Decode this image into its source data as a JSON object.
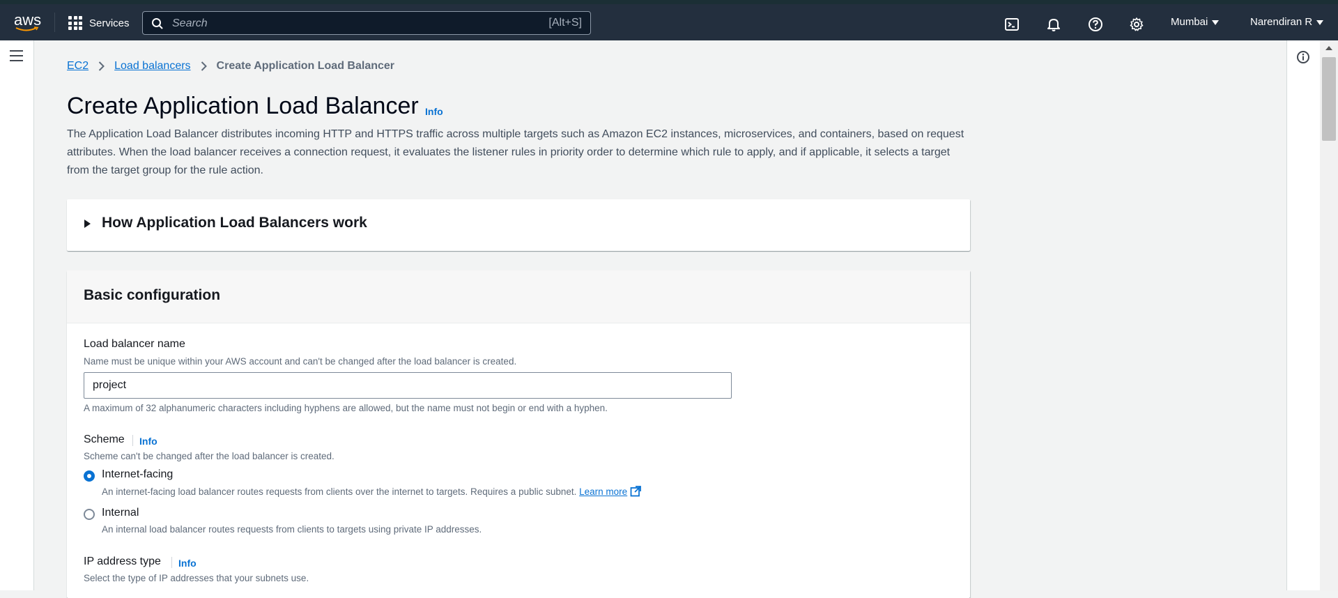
{
  "topbar": {
    "logo_text": "aws",
    "services_label": "Services",
    "search_placeholder": "Search",
    "search_shortcut": "[Alt+S]",
    "region": "Mumbai",
    "user": "Narendiran R"
  },
  "breadcrumb": {
    "items": [
      "EC2",
      "Load balancers"
    ],
    "current": "Create Application Load Balancer"
  },
  "page": {
    "title": "Create Application Load Balancer",
    "info": "Info",
    "description": "The Application Load Balancer distributes incoming HTTP and HTTPS traffic across multiple targets such as Amazon EC2 instances, microservices, and containers, based on request attributes. When the load balancer receives a connection request, it evaluates the listener rules in priority order to determine which rule to apply, and if applicable, it selects a target from the target group for the rule action."
  },
  "how_panel": {
    "title": "How Application Load Balancers work"
  },
  "basic": {
    "title": "Basic configuration",
    "name_label": "Load balancer name",
    "name_desc": "Name must be unique within your AWS account and can't be changed after the load balancer is created.",
    "name_value": "project",
    "name_constraint": "A maximum of 32 alphanumeric characters including hyphens are allowed, but the name must not begin or end with a hyphen.",
    "scheme_label": "Scheme",
    "scheme_info": "Info",
    "scheme_desc": "Scheme can't be changed after the load balancer is created.",
    "scheme_options": [
      {
        "label": "Internet-facing",
        "desc": "An internet-facing load balancer routes requests from clients over the internet to targets. Requires a public subnet.",
        "link": "Learn more",
        "selected": true
      },
      {
        "label": "Internal",
        "desc": "An internal load balancer routes requests from clients to targets using private IP addresses.",
        "selected": false
      }
    ],
    "ip_label": "IP address type",
    "ip_info": "Info",
    "ip_desc": "Select the type of IP addresses that your subnets use."
  },
  "colors": {
    "topbar_bg": "#232f3e",
    "link": "#0972d3",
    "page_bg": "#f2f3f3"
  }
}
